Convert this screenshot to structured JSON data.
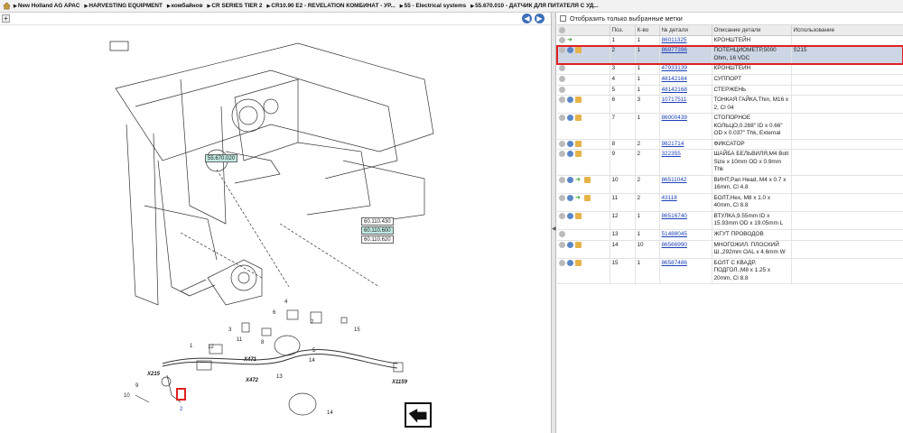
{
  "breadcrumb": [
    "New Holland AG APAC",
    "HARVESTING EQUIPMENT",
    "комбайнов",
    "CR SERIES TIER 2",
    "CR10.90 E2 - REVELATION КОМБИНАТ - УР...",
    "55 - Electrical systems",
    "55.670.010 - ДАТЧИК ДЛЯ ПИТАТЕЛЯ С УД..."
  ],
  "filter_label": "Отобразить только выбранные метки",
  "table": {
    "headers": [
      "Поз.",
      "К-во",
      "№ детали",
      "Описание детали",
      "Использование"
    ],
    "rows": [
      {
        "pos": "1",
        "qty": "1",
        "part": "86011325",
        "desc": "КРОНШТЕЙН",
        "use": "",
        "icons": [
          "grey",
          "green"
        ]
      },
      {
        "pos": "2",
        "qty": "1",
        "part": "86977396",
        "desc": "ПОТЕНЦИОМЕТР,5000 Ohm, 16 VDC",
        "use": "S215",
        "icons": [
          "grey",
          "blue",
          "cube"
        ],
        "selected": true
      },
      {
        "pos": "3",
        "qty": "1",
        "part": "47933139",
        "desc": "КРОНШТЕЙН",
        "use": "",
        "icons": [
          "grey"
        ]
      },
      {
        "pos": "4",
        "qty": "1",
        "part": "48142164",
        "desc": "СУППОРТ",
        "use": "",
        "icons": [
          "grey"
        ]
      },
      {
        "pos": "5",
        "qty": "1",
        "part": "48142168",
        "desc": "СТЕРЖЕНЬ",
        "use": "",
        "icons": [
          "grey"
        ]
      },
      {
        "pos": "6",
        "qty": "3",
        "part": "10717511",
        "desc": "ТОНКАЯ ГАЙКА,Thin, M16 x 2, Cl 04",
        "use": "",
        "icons": [
          "grey",
          "blue",
          "cube"
        ]
      },
      {
        "pos": "7",
        "qty": "1",
        "part": "86000439",
        "desc": "СТОПОРНОЕ КОЛЬЦО,0.288\" ID x 0.66\" OD x 0.037\" Thk, External",
        "use": "",
        "icons": [
          "grey",
          "blue",
          "cube"
        ]
      },
      {
        "pos": "8",
        "qty": "2",
        "part": "9821714",
        "desc": "ФИКСАТОР",
        "use": "",
        "icons": [
          "grey",
          "blue",
          "cube"
        ]
      },
      {
        "pos": "9",
        "qty": "2",
        "part": "322355",
        "desc": "ШАЙБА БЕЛЬВИЛЯ,M4 Bolt Size x 10mm OD x 0.9mm Thk",
        "use": "",
        "icons": [
          "grey",
          "blue",
          "cube"
        ]
      },
      {
        "pos": "10",
        "qty": "2",
        "part": "86511042",
        "desc": "ВИНТ,Pan Head, M4 x 0.7 x 16mm, Cl 4.8",
        "use": "",
        "icons": [
          "grey",
          "blue",
          "green",
          "cube"
        ]
      },
      {
        "pos": "11",
        "qty": "2",
        "part": "43118",
        "desc": "БОЛТ,Hex, M8 x 1.0 x 40mm, Cl 8.8",
        "use": "",
        "icons": [
          "grey",
          "blue",
          "green",
          "cube"
        ]
      },
      {
        "pos": "12",
        "qty": "1",
        "part": "86516740",
        "desc": "ВТУЛКА,9.55mm ID x 15.93mm OD x 19.05mm L",
        "use": "",
        "icons": [
          "grey",
          "blue",
          "cube"
        ]
      },
      {
        "pos": "13",
        "qty": "1",
        "part": "51488045",
        "desc": "ЖГУТ ПРОВОДОВ",
        "use": "",
        "icons": [
          "grey"
        ]
      },
      {
        "pos": "14",
        "qty": "10",
        "part": "86566990",
        "desc": "МНОГОЖИЛ. ПЛОСКИЙ Ш.,292mm OAL x 4.6mm W",
        "use": "",
        "icons": [
          "grey",
          "blue",
          "cube"
        ]
      },
      {
        "pos": "15",
        "qty": "1",
        "part": "86587486",
        "desc": "БОЛТ С КВАДР. ПОДГОЛ.,M8 x 1.25 x 20mm, Cl 8.8",
        "use": "",
        "icons": [
          "grey",
          "blue",
          "cube"
        ]
      }
    ]
  },
  "diagram": {
    "ref_main": "55.670.020",
    "refs": [
      "60.110.430",
      "60.110.600",
      "60.110.620"
    ],
    "callouts": [
      "1",
      "2",
      "3",
      "4",
      "5",
      "6",
      "7",
      "8",
      "9",
      "10",
      "11",
      "12",
      "13",
      "14",
      "15",
      "14"
    ],
    "connectors": [
      "X215",
      "X471",
      "X472",
      "X1159"
    ]
  },
  "colors": {
    "highlight_border": "#e02020",
    "row_selected": "#cdd6e4",
    "link": "#1a3fb5"
  }
}
